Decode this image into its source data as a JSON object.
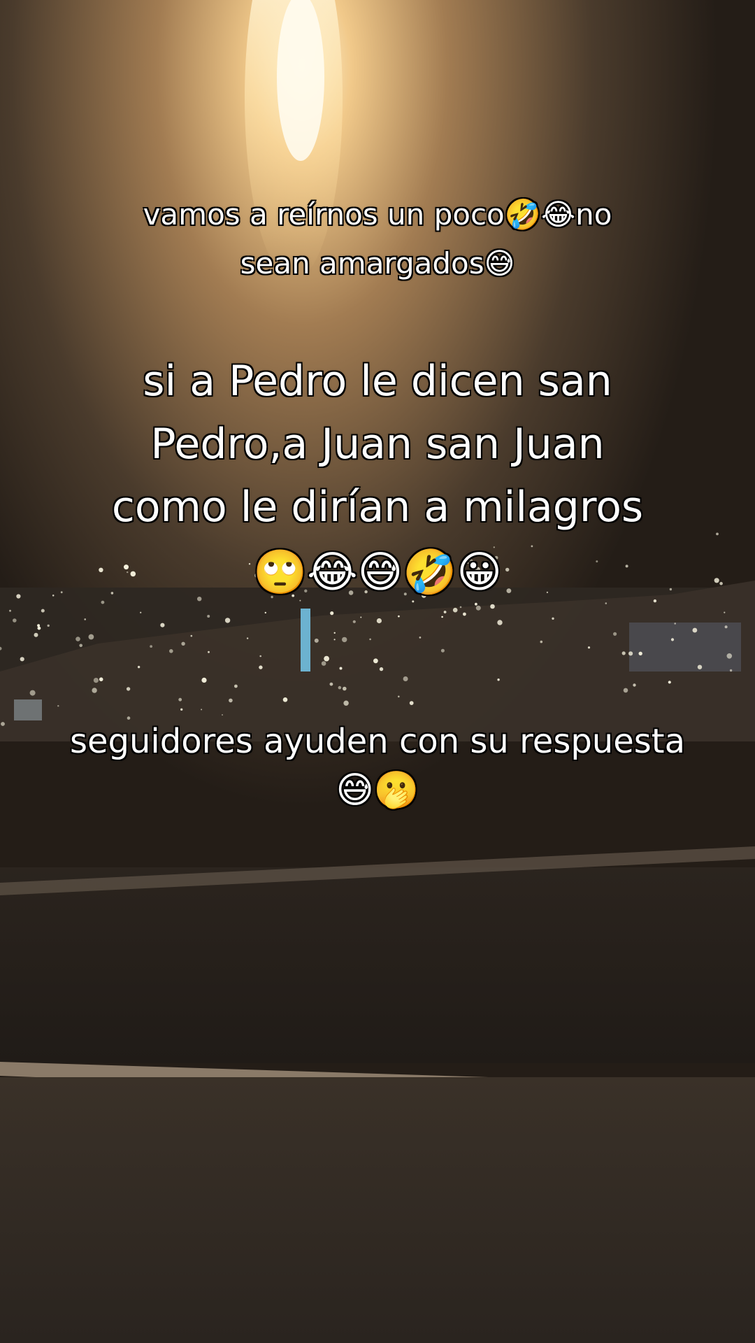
{
  "captions": {
    "top": {
      "line1": "vamos a reírnos un poco🤣😂no",
      "line2": "sean amargados😅"
    },
    "main": {
      "line1": "si a Pedro le dicen san",
      "line2": "Pedro,a Juan san Juan",
      "line3": "como le dirían a milagros",
      "line4": "🙄😂😅🤣😀"
    },
    "bottom": {
      "line1": "seguidores ayuden con su respuesta",
      "line2": "😅🫢"
    }
  },
  "colors": {
    "caption_text": "#ffffff",
    "caption_outline": "#000000",
    "light_glow": "#fff1c8",
    "sky": "#3a2e22",
    "city_lights": "#f4f0dc",
    "ground": "#2b2620"
  }
}
